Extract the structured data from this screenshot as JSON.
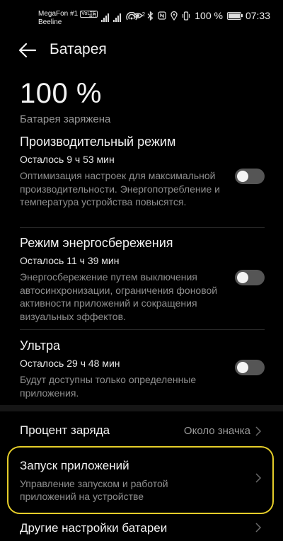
{
  "status_bar": {
    "carrier_1": "MegaFon #1",
    "volte_badge": "VoLTE",
    "carrier_2": "Beeline",
    "network_type": "4G",
    "hotspot_count": "2",
    "battery_percent": "100 %",
    "time": "07:33"
  },
  "header": {
    "title": "Батарея"
  },
  "battery": {
    "percent_text": "100 %",
    "status_text": "Батарея заряжена",
    "level_fraction": 1.0
  },
  "modes": [
    {
      "title": "Производительный режим",
      "remaining": "Осталось 9 ч 53 мин",
      "description": "Оптимизация настроек для максимальной производительности. Энергопотребление и температура устройства повысятся.",
      "enabled": false
    },
    {
      "title": "Режим энергосбережения",
      "remaining": "Осталось 11 ч 39 мин",
      "description": "Энергосбережение путем выключения автосинхронизации, ограничения фоновой активности приложений и сокращения визуальных эффектов.",
      "enabled": false
    },
    {
      "title": "Ультра",
      "remaining": "Осталось 29 ч 48 мин",
      "description": "Будут доступны только определенные приложения.",
      "enabled": false
    }
  ],
  "settings": {
    "charge_percent": {
      "label": "Процент заряда",
      "value": "Около значка"
    },
    "app_launch": {
      "label": "Запуск приложений",
      "description": "Управление запуском и работой приложений на устройстве"
    },
    "other_settings": {
      "label": "Другие настройки батареи"
    }
  },
  "colors": {
    "background": "#000000",
    "highlight": "#e5cd2a",
    "toggle_off": "#555555"
  }
}
